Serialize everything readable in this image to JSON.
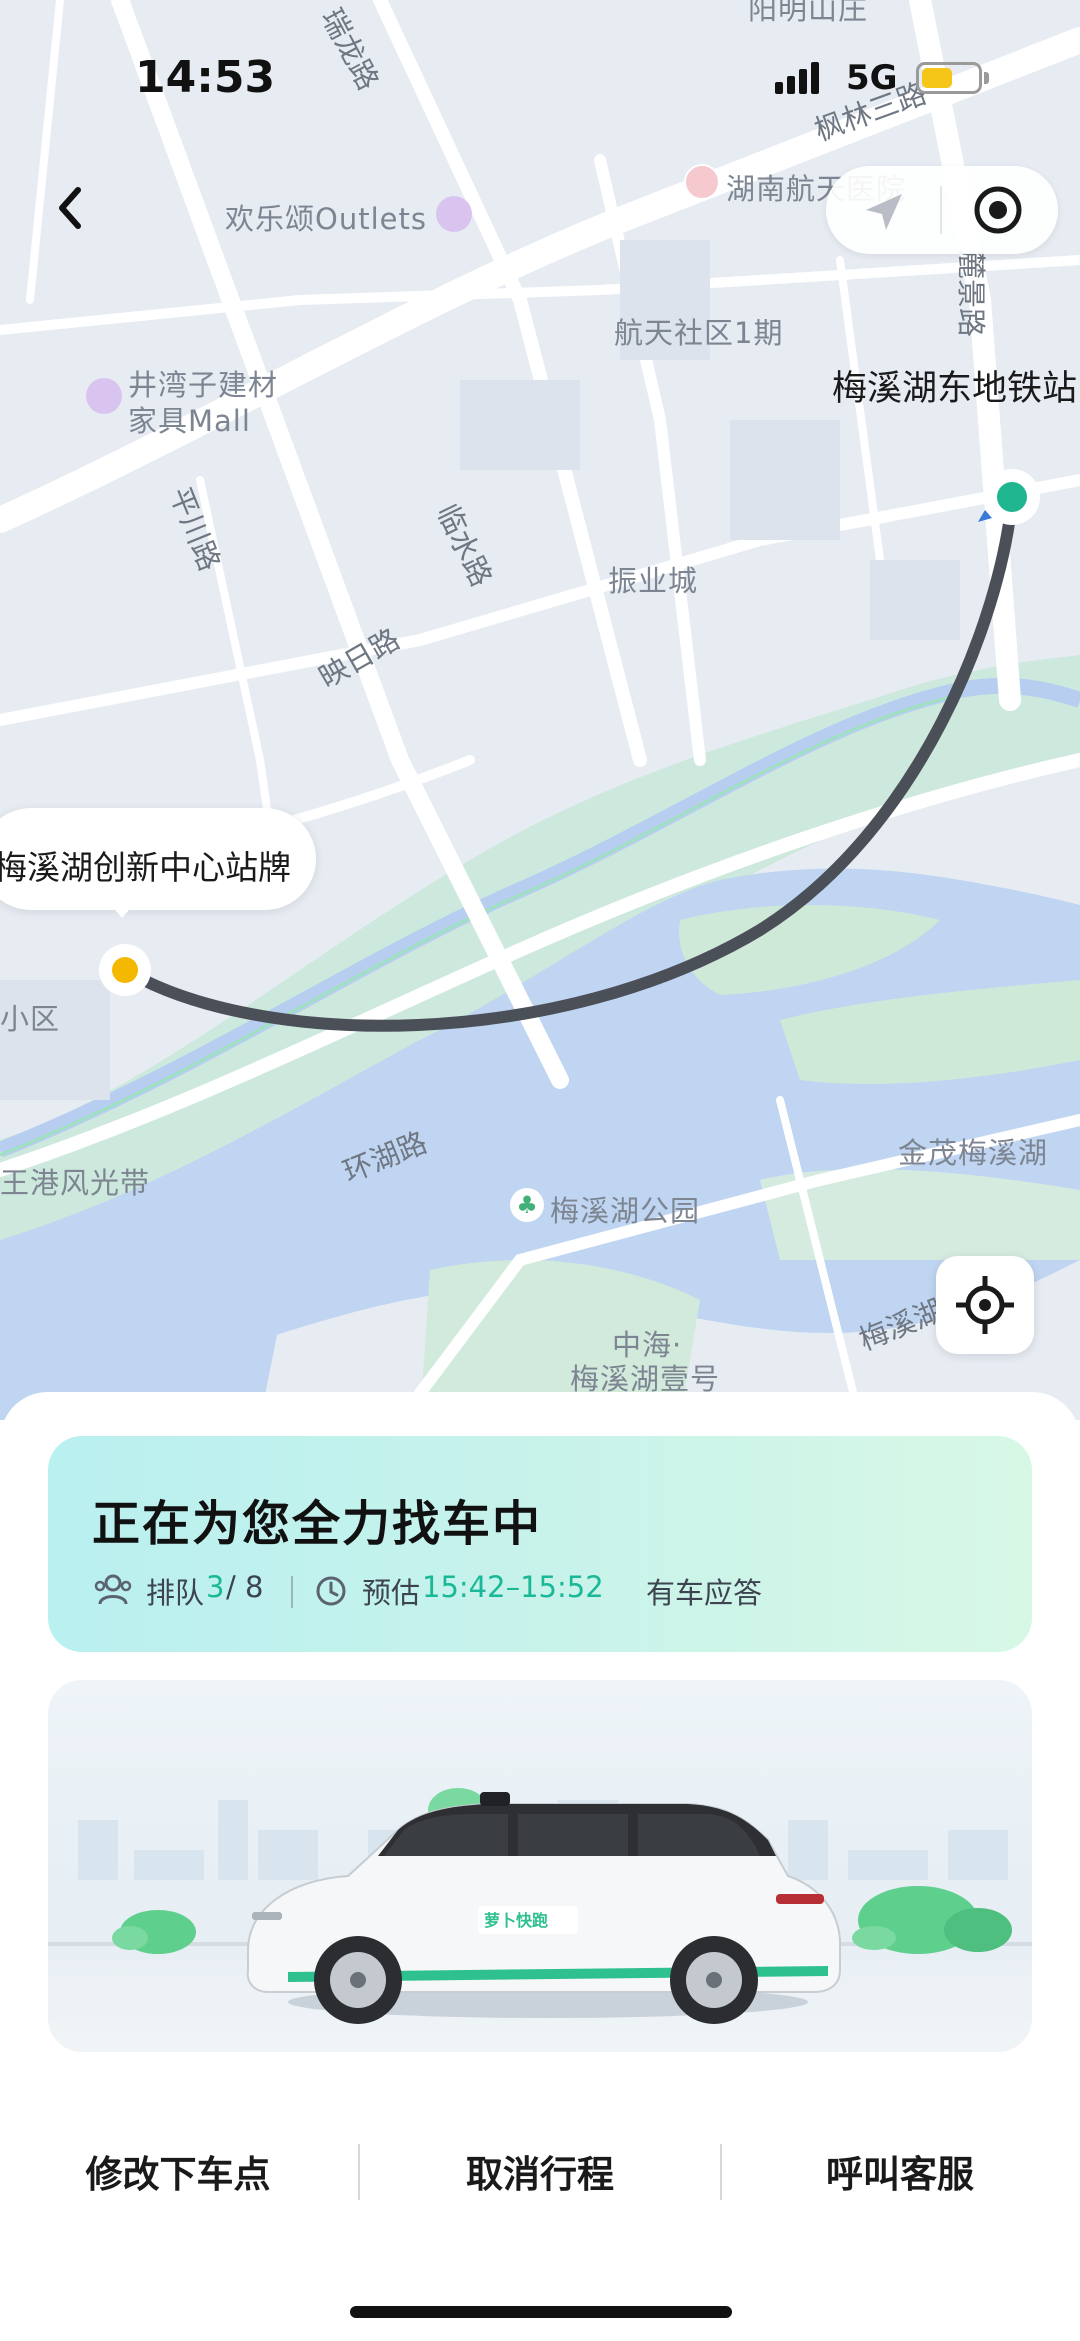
{
  "status_bar": {
    "time": "14:53",
    "network": "5G"
  },
  "map": {
    "labels": {
      "outlets": "欢乐颂Outlets",
      "hospital": "湖南航天医院",
      "community": "航天社区1期",
      "mall": "井湾子建材\n家具Mall",
      "mall_line1": "井湾子建材",
      "mall_line2": "家具Mall",
      "zhenye": "振业城",
      "jinmao": "金茂梅溪湖",
      "park": "梅溪湖公园",
      "zhonghai_1": "中海·",
      "zhonghai_2": "梅溪湖壹号",
      "fengguang": "王港风光带",
      "xiaoqu": "小区",
      "yangming": "阳明山庄"
    },
    "roads": {
      "ruilong": "瑞龙路",
      "pingchuan": "平川路",
      "linshui": "临水路",
      "yingri": "映日路",
      "huanhu": "环湖路",
      "fenglin": "枫林三路",
      "lijing": "麓景路",
      "meixihu_road": "梅溪湖路"
    },
    "pickup_label": "梅溪湖创新中心站牌",
    "destination_label": "梅溪湖东地铁站",
    "route_color": "#4b5058",
    "pickup_color": "#f5b800",
    "destination_color": "#1fb58f"
  },
  "status_card": {
    "title": "正在为您全力找车中",
    "queue_label": "排队",
    "queue_position": "3",
    "queue_total": "/ 8",
    "eta_prefix": "预估",
    "eta_range": "15:42–15:52",
    "eta_suffix": "有车应答"
  },
  "vehicle": {
    "brand_text": "萝卜快跑"
  },
  "actions": {
    "modify_dropoff": "修改下车点",
    "cancel_trip": "取消行程",
    "call_service": "呼叫客服"
  },
  "icons": [
    "back-icon",
    "navigate-arrow-icon",
    "target-icon",
    "locate-icon",
    "people-icon",
    "clock-icon",
    "tree-icon",
    "shopping-bag-icon",
    "hospital-icon"
  ],
  "colors": {
    "accent": "#19b896",
    "card_gradient_start": "#b9f0f0",
    "card_gradient_end": "#d8f8e6"
  }
}
